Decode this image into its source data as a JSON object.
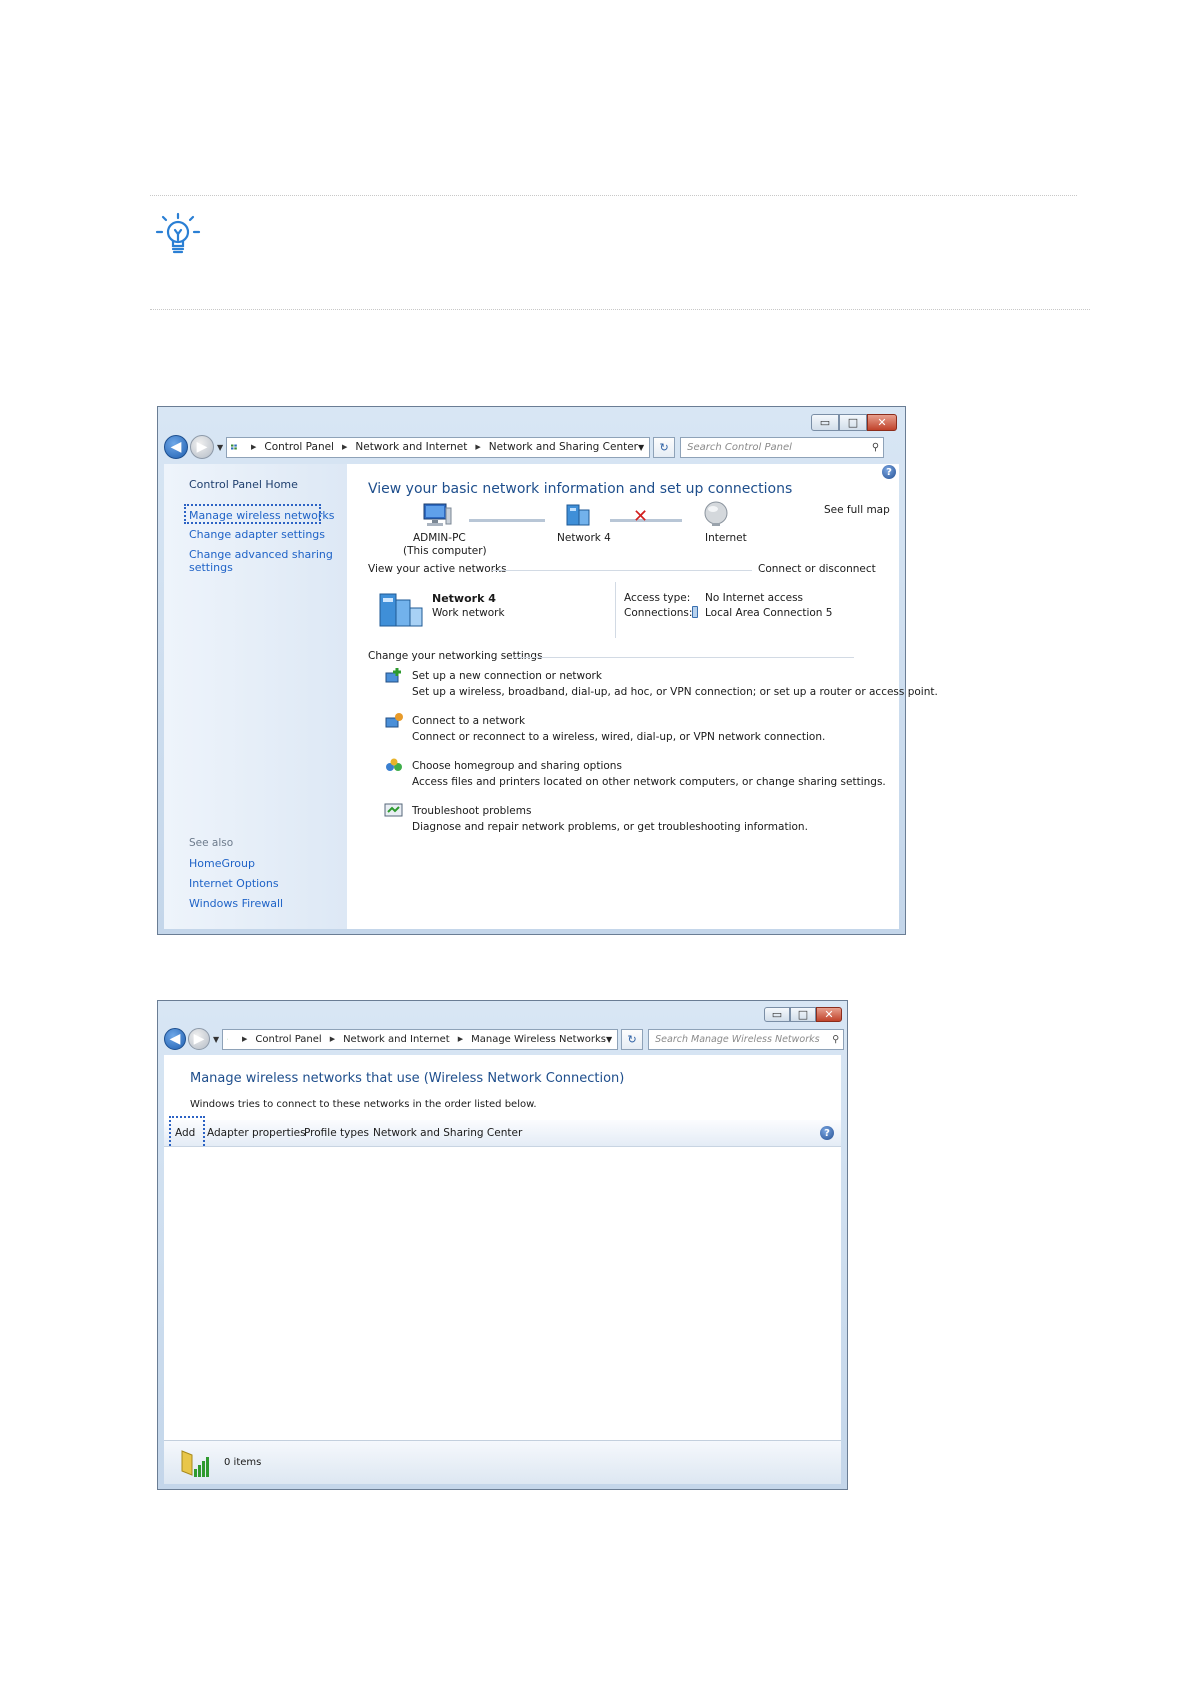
{
  "window1": {
    "address": {
      "crumbs": [
        "Control Panel",
        "Network and Internet",
        "Network and Sharing Center"
      ],
      "search_placeholder": "Search Control Panel"
    },
    "sidebar": {
      "home": "Control Panel Home",
      "items": [
        "Manage wireless networks",
        "Change adapter settings",
        "Change advanced sharing",
        "settings"
      ],
      "see_also_label": "See also",
      "see_also": [
        "HomeGroup",
        "Internet Options",
        "Windows Firewall"
      ]
    },
    "main": {
      "title": "View your basic network information and set up connections",
      "see_full_map": "See full map",
      "map": {
        "computer_name": "ADMIN-PC",
        "computer_sub": "(This computer)",
        "network": "Network 4",
        "internet": "Internet"
      },
      "active_networks_label": "View your active networks",
      "connect_disconnect": "Connect or disconnect",
      "network_name": "Network 4",
      "network_type": "Work network",
      "access_type_label": "Access type:",
      "access_type_value": "No Internet access",
      "connections_label": "Connections:",
      "connections_value": "Local Area Connection 5",
      "settings_label": "Change your networking settings",
      "tasks": [
        {
          "title": "Set up a new connection or network",
          "desc": "Set up a wireless, broadband, dial-up, ad hoc, or VPN connection; or set up a router or access point."
        },
        {
          "title": "Connect to a network",
          "desc": "Connect or reconnect to a wireless, wired, dial-up, or VPN network connection."
        },
        {
          "title": "Choose homegroup and sharing options",
          "desc": "Access files and printers located on other network computers, or change sharing settings."
        },
        {
          "title": "Troubleshoot problems",
          "desc": "Diagnose and repair network problems, or get troubleshooting information."
        }
      ]
    }
  },
  "window2": {
    "address": {
      "crumbs": [
        "Control Panel",
        "Network and Internet",
        "Manage Wireless Networks"
      ],
      "search_placeholder": "Search Manage Wireless Networks"
    },
    "title": "Manage wireless networks that use (Wireless Network Connection)",
    "subtitle": "Windows tries to connect to these networks in the order listed below.",
    "toolbar": [
      "Add",
      "Adapter properties",
      "Profile types",
      "Network and Sharing Center"
    ],
    "status": "0 items"
  },
  "colors": {
    "link": "#1f63c7",
    "title": "#1e4e8c",
    "highlight": "#2b62c4"
  }
}
